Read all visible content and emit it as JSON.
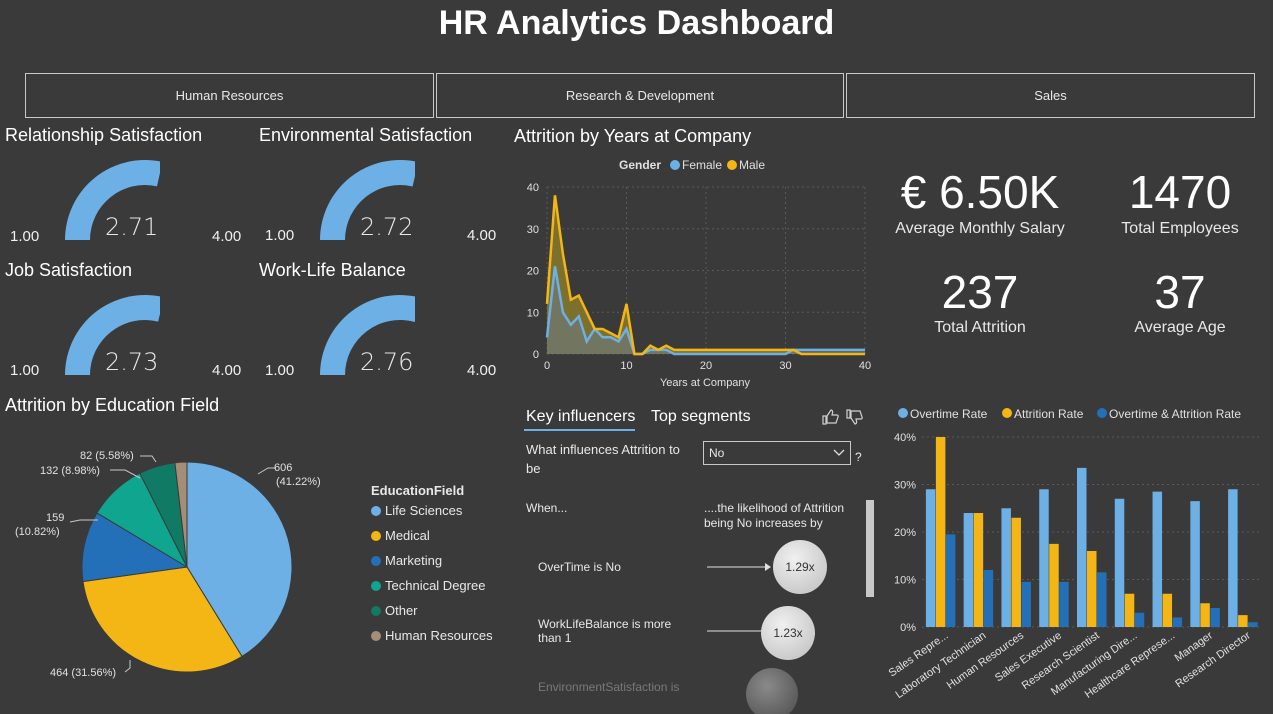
{
  "title": "HR Analytics Dashboard",
  "departments": [
    "Human Resources",
    "Research & Development",
    "Sales"
  ],
  "gauges": [
    {
      "title": "Relationship Satisfaction",
      "min": "1.00",
      "max": "4.00",
      "value": "2.71",
      "value_num": 2.71
    },
    {
      "title": "Environmental Satisfaction",
      "min": "1.00",
      "max": "4.00",
      "value": "2.72",
      "value_num": 2.72
    },
    {
      "title": "Job Satisfaction",
      "min": "1.00",
      "max": "4.00",
      "value": "2.73",
      "value_num": 2.73
    },
    {
      "title": "Work-Life Balance",
      "min": "1.00",
      "max": "4.00",
      "value": "2.76",
      "value_num": 2.76
    }
  ],
  "kpis": [
    {
      "value": "€ 6.50K",
      "label": "Average Monthly Salary"
    },
    {
      "value": "1470",
      "label": "Total Employees"
    },
    {
      "value": "237",
      "label": "Total Attrition"
    },
    {
      "value": "37",
      "label": "Average Age"
    }
  ],
  "colors": {
    "female": "#6cb0e6",
    "male": "#f4b614",
    "blue_light": "#6cb0e6",
    "yellow": "#f4b614",
    "blue_dark": "#2470b8",
    "teal": "#10a58e",
    "dark_teal": "#117a65",
    "tan": "#a58d76",
    "bg": "#3a3a3a"
  },
  "area_chart": {
    "title": "Attrition by Years at Company",
    "legend_title": "Gender",
    "chart_data": {
      "type": "area",
      "xlabel": "Years at Company",
      "ylabel": "",
      "xlim": [
        0,
        40
      ],
      "ylim": [
        0,
        40
      ],
      "xticks": [
        "0",
        "10",
        "20",
        "30",
        "40"
      ],
      "yticks": [
        "0",
        "10",
        "20",
        "30",
        "40"
      ],
      "x": [
        0,
        1,
        2,
        3,
        4,
        5,
        6,
        7,
        8,
        9,
        10,
        11,
        12,
        13,
        14,
        15,
        16,
        17,
        18,
        19,
        20,
        21,
        22,
        23,
        24,
        25,
        26,
        27,
        28,
        29,
        30,
        31,
        32,
        33,
        34,
        35,
        36,
        37,
        38,
        39,
        40
      ],
      "series": [
        {
          "name": "Female",
          "values": [
            4,
            21,
            10,
            7,
            9,
            3,
            6,
            4,
            4,
            3,
            6,
            0,
            0,
            1,
            1,
            1,
            0,
            0,
            0,
            0,
            0,
            0,
            0,
            0,
            0,
            0,
            0,
            0,
            0,
            0,
            0,
            1,
            1,
            1,
            1,
            1,
            1,
            1,
            1,
            1,
            1
          ]
        },
        {
          "name": "Male",
          "values": [
            12,
            38,
            24,
            13,
            14,
            10,
            6,
            6,
            5,
            4,
            12,
            0,
            0,
            2,
            1,
            2,
            1,
            1,
            1,
            1,
            1,
            1,
            1,
            1,
            1,
            1,
            1,
            1,
            1,
            1,
            1,
            1,
            0,
            0,
            0,
            0,
            0,
            0,
            0,
            0,
            0
          ]
        }
      ]
    }
  },
  "pie_chart": {
    "title": "Attrition by Education Field",
    "legend_title": "EducationField",
    "chart_data": {
      "type": "pie",
      "categories": [
        "Life Sciences",
        "Medical",
        "Marketing",
        "Technical Degree",
        "Other",
        "Human Resources"
      ],
      "values": [
        606,
        464,
        159,
        132,
        82,
        27
      ],
      "labels": [
        "606",
        "(41.22%)",
        "464 (31.56%)",
        "159",
        "(10.82%)",
        "132 (8.98%)",
        "82 (5.58%)"
      ]
    }
  },
  "key_influencers": {
    "tab_active": "Key influencers",
    "tab_other": "Top segments",
    "question_line1": "What influences Attrition to",
    "question_line2": "be",
    "dropdown_value": "No",
    "question_mark": "?",
    "col_when": "When...",
    "col_likelihood_1": "....the likelihood of Attrition",
    "col_likelihood_2": "being No increases by",
    "rows": [
      {
        "label1": "OverTime is No",
        "label2": "",
        "value": "1.29x"
      },
      {
        "label1": "WorkLifeBalance is more",
        "label2": "than 1",
        "value": "1.23x"
      },
      {
        "label1": "EnvironmentSatisfaction is",
        "label2": "",
        "value": ""
      }
    ]
  },
  "bar_chart": {
    "chart_data": {
      "type": "bar",
      "categories": [
        "Sales Repre...",
        "Laboratory Technician",
        "Human Resources",
        "Sales Executive",
        "Research Scientist",
        "Manufacturing Dire...",
        "Healthcare Represe...",
        "Manager",
        "Research Director"
      ],
      "series": [
        {
          "name": "Overtime Rate",
          "values": [
            29,
            24,
            25,
            29,
            33.5,
            27,
            28.5,
            26.5,
            29
          ]
        },
        {
          "name": "Attrition Rate",
          "values": [
            40,
            24,
            23,
            17.5,
            16,
            7,
            7,
            5,
            2.5
          ]
        },
        {
          "name": "Overtime & Attrition Rate",
          "values": [
            19.5,
            12,
            9.5,
            9.5,
            11.5,
            3,
            2,
            4,
            1
          ]
        }
      ],
      "ylim": [
        0,
        40
      ],
      "yticks": [
        "0%",
        "10%",
        "20%",
        "30%",
        "40%"
      ]
    }
  }
}
